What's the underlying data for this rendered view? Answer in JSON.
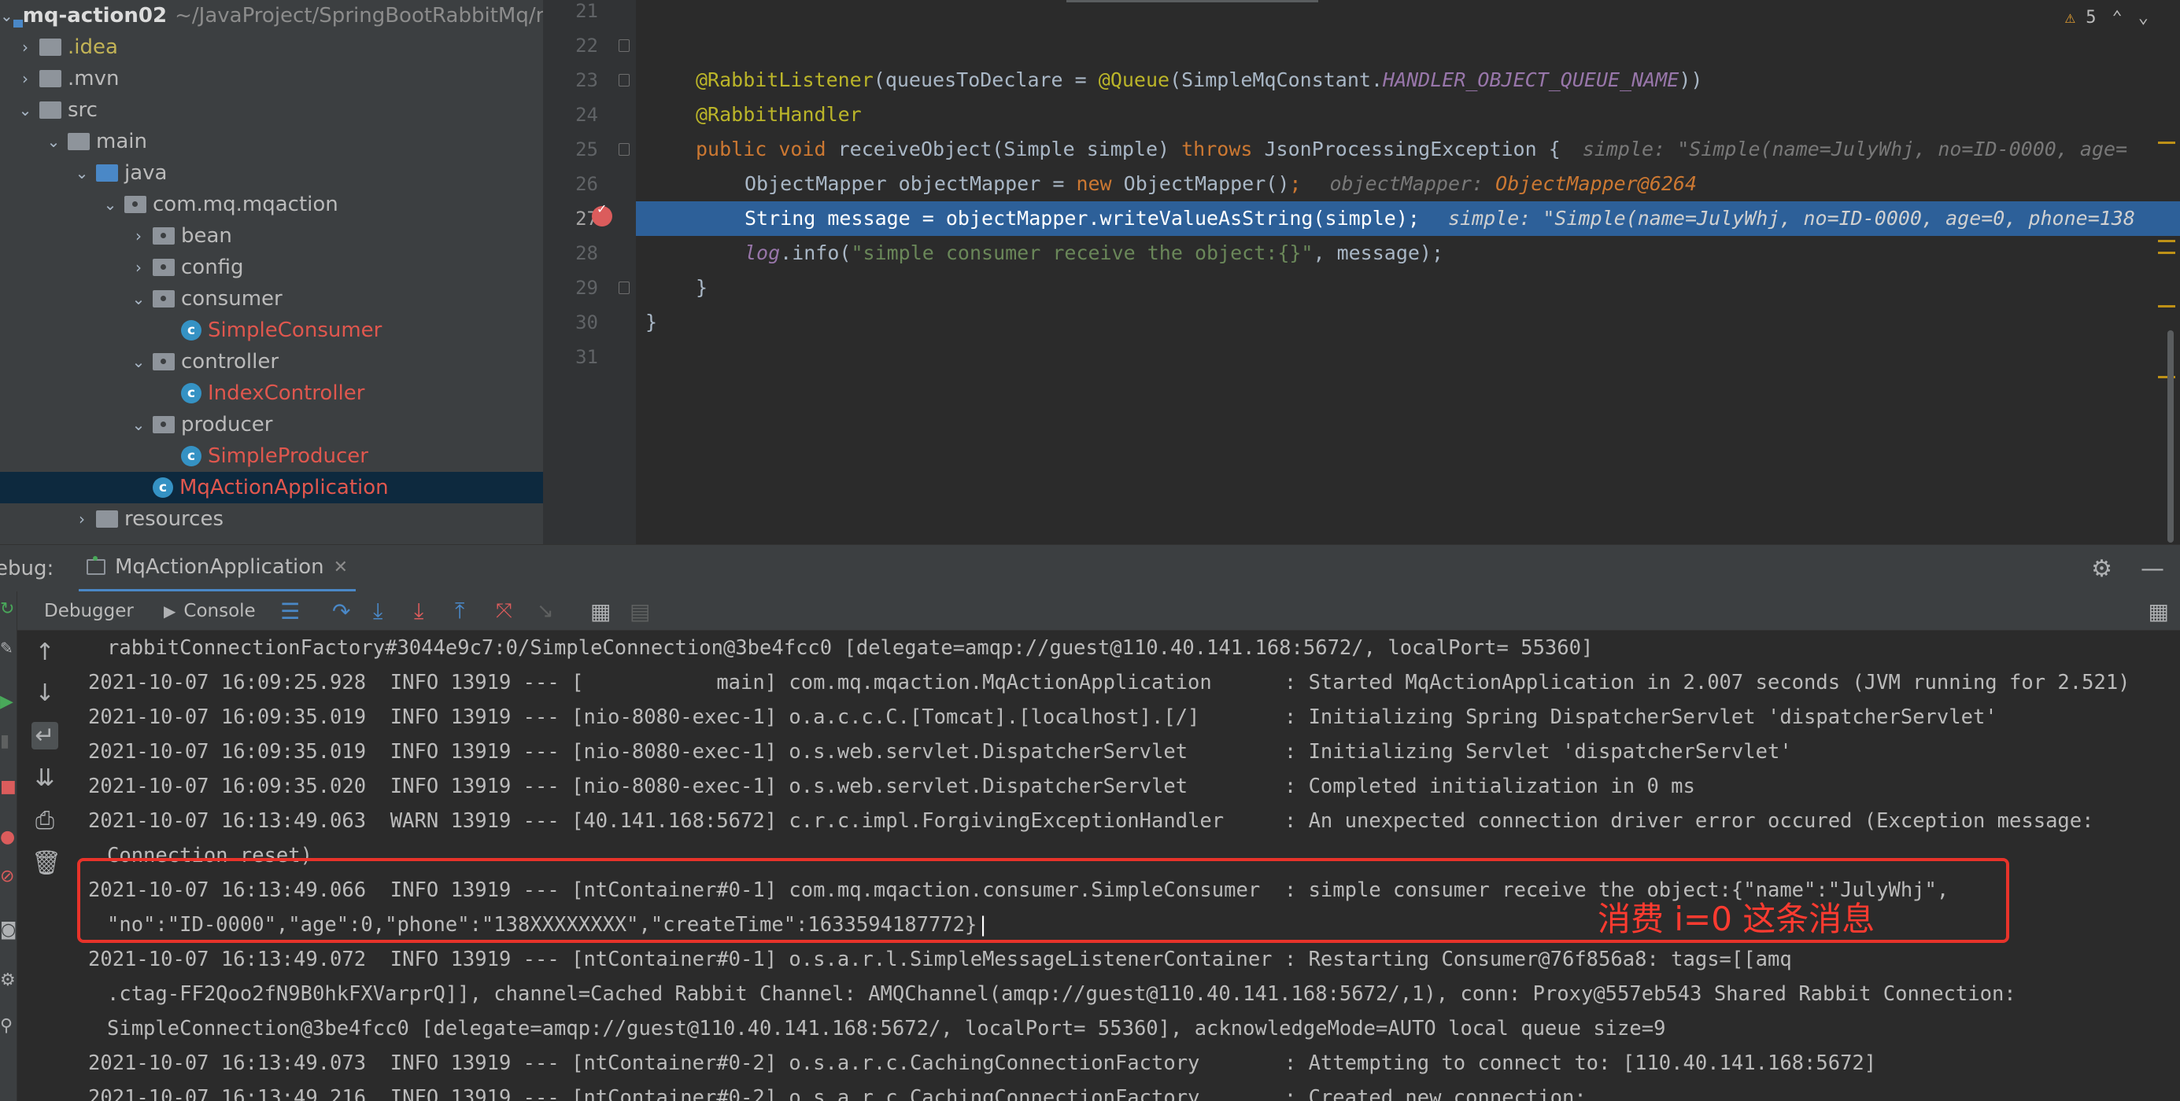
{
  "project_tree": {
    "root_name": "mq-action02",
    "root_path": "~/JavaProject/SpringBootRabbitMq/r",
    "items": [
      {
        "label": "idea",
        "prefix": "."
      },
      {
        "label": ".mvn"
      },
      {
        "label": "src"
      },
      {
        "label": "main"
      },
      {
        "label": "java"
      },
      {
        "label": "com.mq.mqaction"
      },
      {
        "label": "bean"
      },
      {
        "label": "config"
      },
      {
        "label": "consumer"
      },
      {
        "label": "SimpleConsumer"
      },
      {
        "label": "controller"
      },
      {
        "label": "IndexController"
      },
      {
        "label": "producer"
      },
      {
        "label": "SimpleProducer"
      },
      {
        "label": "MqActionApplication"
      },
      {
        "label": "resources"
      }
    ]
  },
  "editor": {
    "warning_count": "5",
    "line_numbers": [
      "21",
      "22",
      "23",
      "24",
      "25",
      "26",
      "27",
      "28",
      "29",
      "30",
      "31"
    ],
    "line23": {
      "a1": "@RabbitListener",
      "a2": "(queuesToDeclare = ",
      "a3": "@Queue",
      "a4": "(SimpleMqConstant.",
      "a5": "HANDLER_OBJECT_QUEUE_NAME",
      "a6": "))"
    },
    "line24": "@RabbitHandler",
    "line25": {
      "kw": "public void ",
      "method": "receiveObject",
      "params": "(Simple simple) ",
      "throws": "throws ",
      "exc": "JsonProcessingException {",
      "hint": "simple: \"Simple(name=JulyWhj, no=ID-0000, age="
    },
    "line26": {
      "code": "ObjectMapper objectMapper = ",
      "kw": "new ",
      "code2": "ObjectMapper()",
      "semi": ";",
      "hint": "objectMapper: ",
      "hint_val": "ObjectMapper@6264"
    },
    "line27": {
      "code": "String message = objectMapper.writeValueAsString(simple);",
      "hint": "simple: \"Simple(name=JulyWhj, no=ID-0000, age=0, phone=138"
    },
    "line28": {
      "field": "log",
      "code": ".info(",
      "str": "\"simple consumer receive the object:{}\"",
      "code2": ", message);"
    },
    "line29": "}",
    "line30": "}"
  },
  "debug": {
    "label": "ebug:",
    "run_config": "MqActionApplication",
    "tabs": {
      "debugger": "Debugger",
      "console": "Console"
    }
  },
  "console": {
    "lines": [
      "rabbitConnectionFactory#3044e9c7:0/SimpleConnection@3be4fcc0 [delegate=amqp://guest@110.40.141.168:5672/, localPort= 55360]",
      "2021-10-07 16:09:25.928  INFO 13919 --- [           main] com.mq.mqaction.MqActionApplication      : Started MqActionApplication in 2.007 seconds (JVM running for 2.521)",
      "2021-10-07 16:09:35.019  INFO 13919 --- [nio-8080-exec-1] o.a.c.c.C.[Tomcat].[localhost].[/]       : Initializing Spring DispatcherServlet 'dispatcherServlet'",
      "2021-10-07 16:09:35.019  INFO 13919 --- [nio-8080-exec-1] o.s.web.servlet.DispatcherServlet        : Initializing Servlet 'dispatcherServlet'",
      "2021-10-07 16:09:35.020  INFO 13919 --- [nio-8080-exec-1] o.s.web.servlet.DispatcherServlet        : Completed initialization in 0 ms",
      "2021-10-07 16:13:49.063  WARN 13919 --- [40.141.168:5672] c.r.c.impl.ForgivingExceptionHandler     : An unexpected connection driver error occured (Exception message:",
      "Connection reset)",
      "2021-10-07 16:13:49.066  INFO 13919 --- [ntContainer#0-1] com.mq.mqaction.consumer.SimpleConsumer  : simple consumer receive the object:{\"name\":\"JulyWhj\",",
      "\"no\":\"ID-0000\",\"age\":0,\"phone\":\"138XXXXXXXX\",\"createTime\":1633594187772}",
      "2021-10-07 16:13:49.072  INFO 13919 --- [ntContainer#0-1] o.s.a.r.l.SimpleMessageListenerContainer : Restarting Consumer@76f856a8: tags=[[amq",
      ".ctag-FF2Qoo2fN9B0hkFXVarprQ]], channel=Cached Rabbit Channel: AMQChannel(amqp://guest@110.40.141.168:5672/,1), conn: Proxy@557eb543 Shared Rabbit Connection:",
      "SimpleConnection@3be4fcc0 [delegate=amqp://guest@110.40.141.168:5672/, localPort= 55360], acknowledgeMode=AUTO local queue size=9",
      "2021-10-07 16:13:49.073  INFO 13919 --- [ntContainer#0-2] o.s.a.r.c.CachingConnectionFactory       : Attempting to connect to: [110.40.141.168:5672]",
      "2021-10-07 16:13:49.216  INFO 13919 --- [ntContainer#0-2] o.s.a.r.c.CachingConnectionFactory       : Created new connection:"
    ],
    "annotation": "消费 i=0 这条消息"
  },
  "colors": {
    "highlight": "#2d6099",
    "annotation": "#e8332a",
    "accent": "#4a88c7"
  }
}
